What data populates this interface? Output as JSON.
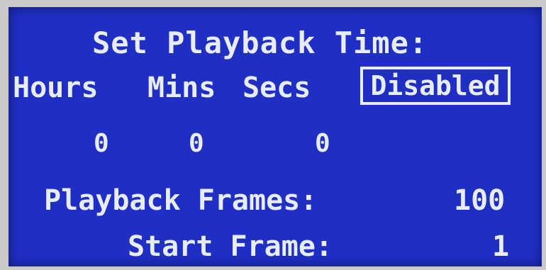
{
  "title": "Set Playback Time:",
  "time_fields": {
    "hours_label": "Hours",
    "mins_label": "Mins",
    "secs_label": "Secs",
    "hours_value": "0",
    "mins_value": "0",
    "secs_value": "0"
  },
  "mode_toggle": {
    "label": "Disabled"
  },
  "playback_frames": {
    "label": "Playback Frames:",
    "value": "100"
  },
  "start_frame": {
    "label": "Start Frame:",
    "value": "1"
  },
  "colors": {
    "screen_background": "#1f2fc4",
    "text": "#e8ecf6",
    "bezel": "#c9c9cc"
  }
}
